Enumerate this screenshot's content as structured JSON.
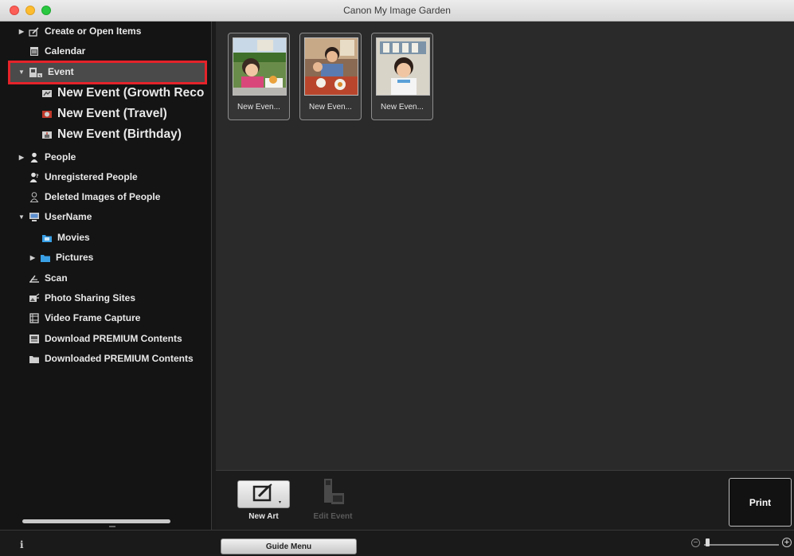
{
  "window": {
    "title": "Canon My Image Garden"
  },
  "sidebar": {
    "items": [
      {
        "label": "Create or Open Items",
        "icon": "create-items-icon"
      },
      {
        "label": "Calendar",
        "icon": "calendar-icon"
      },
      {
        "label": "Event",
        "icon": "event-icon"
      },
      {
        "label": "New Event (Growth Reco",
        "icon": "event-growth-icon"
      },
      {
        "label": "New Event (Travel)",
        "icon": "event-travel-icon"
      },
      {
        "label": "New Event (Birthday)",
        "icon": "event-birthday-icon"
      },
      {
        "label": "People",
        "icon": "person-icon"
      },
      {
        "label": "Unregistered People",
        "icon": "unregistered-person-icon"
      },
      {
        "label": "Deleted Images of People",
        "icon": "deleted-person-icon"
      },
      {
        "label": "UserName",
        "icon": "computer-icon"
      },
      {
        "label": "Movies",
        "icon": "folder-icon"
      },
      {
        "label": "Pictures",
        "icon": "folder-icon"
      },
      {
        "label": "Scan",
        "icon": "scan-icon"
      },
      {
        "label": "Photo Sharing Sites",
        "icon": "photo-sharing-icon"
      },
      {
        "label": "Video Frame Capture",
        "icon": "video-frame-icon"
      },
      {
        "label": "Download PREMIUM Contents",
        "icon": "download-icon"
      },
      {
        "label": "Downloaded PREMIUM Contents",
        "icon": "downloaded-folder-icon"
      }
    ]
  },
  "main": {
    "thumbnails": [
      {
        "caption": "New Even..."
      },
      {
        "caption": "New Even..."
      },
      {
        "caption": "New Even..."
      }
    ]
  },
  "toolbar": {
    "new_art_label": "New Art",
    "edit_event_label": "Edit Event",
    "print_label": "Print"
  },
  "statusbar": {
    "info_label": "i",
    "guide_menu_label": "Guide Menu",
    "zoom_minus": "−",
    "zoom_plus": "+",
    "zoom_level": 0.02
  },
  "colors": {
    "selection_highlight": "#e5232a",
    "sidebar_bg": "#141414",
    "main_bg": "#2a2a2a"
  }
}
